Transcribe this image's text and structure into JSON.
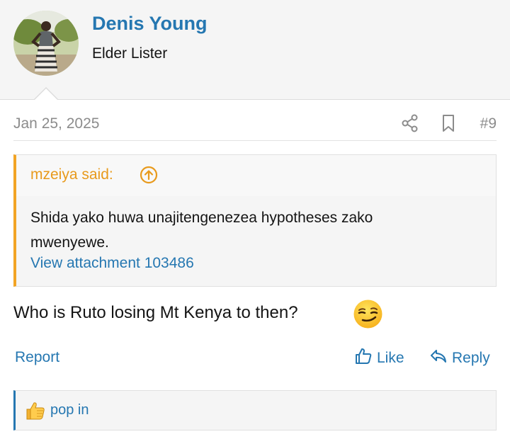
{
  "user": {
    "name": "Denis Young",
    "title": "Elder Lister"
  },
  "post": {
    "date": "Jan 25, 2025",
    "number": "#9",
    "quote": {
      "author_said": "mzeiya said:",
      "text": "Shida yako huwa unajitengenezea hypotheses zako mwenyewe.",
      "attachment_link": "View attachment 103486"
    },
    "body": "Who is Ruto losing Mt Kenya to then?",
    "emoji": "smirking-face",
    "actions": {
      "report": "Report",
      "like": "Like",
      "reply": "Reply"
    }
  },
  "reactions": {
    "icon": "thumbs-up",
    "users": "pop in"
  },
  "colors": {
    "link": "#2577b1",
    "quote_accent": "#f2a424",
    "muted": "#8c8c8c"
  }
}
